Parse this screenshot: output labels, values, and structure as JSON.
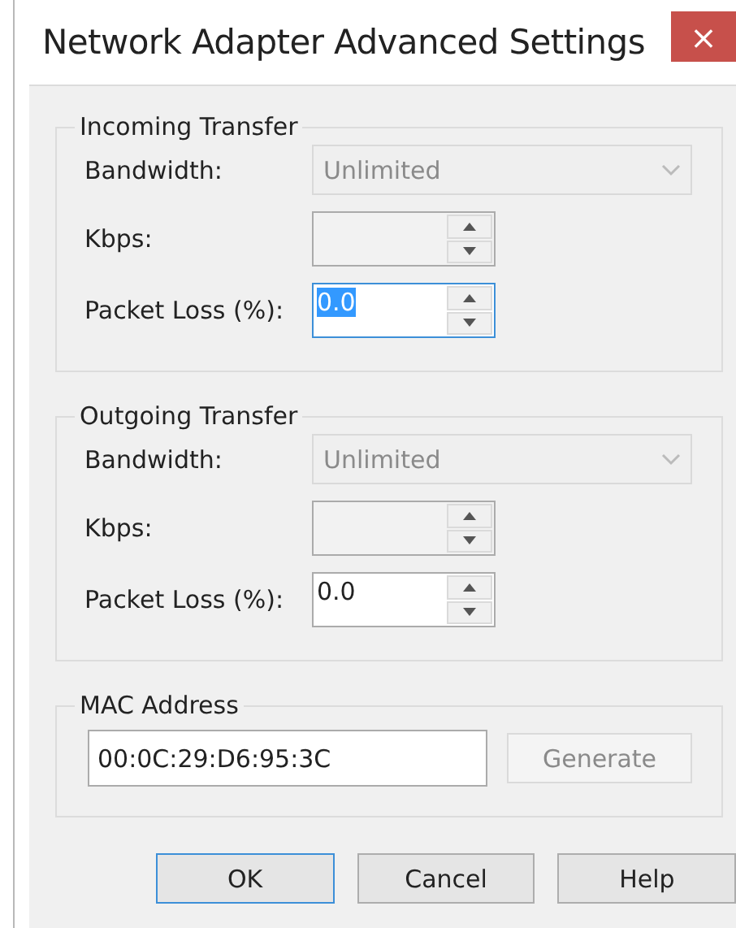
{
  "window": {
    "title": "Network Adapter Advanced Settings",
    "close": "×"
  },
  "groups": [
    {
      "title": "Incoming Transfer",
      "fields": [
        {
          "kind": "combo",
          "label": "Bandwidth:",
          "value": "Unlimited",
          "disabled": true
        },
        {
          "kind": "spin",
          "label": "Kbps:",
          "disabled": true
        },
        {
          "kind": "spin",
          "label": "Packet Loss (%):",
          "value": "0.0",
          "disabled": false,
          "focused": true
        }
      ]
    },
    {
      "title": "Outgoing Transfer",
      "fields": [
        {
          "kind": "combo",
          "label": "Bandwidth:",
          "value": "Unlimited",
          "disabled": true
        },
        {
          "kind": "spin",
          "label": "Kbps:",
          "disabled": true
        },
        {
          "kind": "spin",
          "label": "Packet Loss (%):",
          "value": "0.0",
          "disabled": false,
          "focused": false
        }
      ]
    }
  ],
  "mac": {
    "title": "MAC Address",
    "value": "00:0C:29:D6:95:3C",
    "button": {
      "label": "Generate",
      "disabled": true
    }
  },
  "buttons": [
    {
      "label": "OK",
      "default": true
    },
    {
      "label": "Cancel",
      "default": false
    },
    {
      "label": "Help",
      "default": false
    }
  ]
}
